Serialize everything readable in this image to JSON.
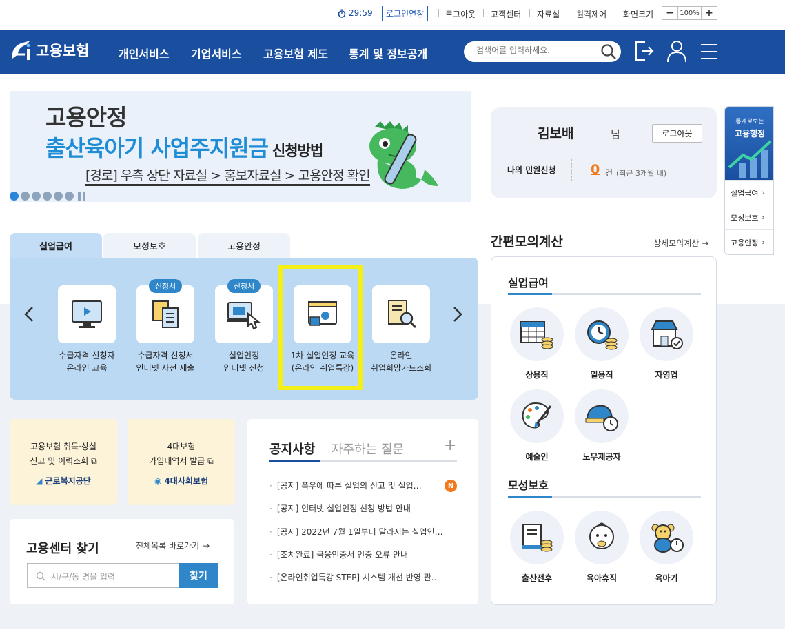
{
  "util": {
    "timer": "29:59",
    "extend": "로그인연장",
    "logout": "로그아웃",
    "support": "고객센터",
    "library": "자료실",
    "remote": "원격제어",
    "screen_size": "화면크기",
    "zoom_minus": "−",
    "zoom_value": "100%",
    "zoom_plus": "+"
  },
  "header": {
    "logo": "고용보험",
    "nav": [
      "개인서비스",
      "기업서비스",
      "고용보험 제도",
      "통계 및 정보공개"
    ],
    "search_placeholder": "검색어를 입력하세요."
  },
  "banner": {
    "line1": "고용안정",
    "line2": "출산육아기 사업주지원금",
    "line2_small": "신청방법",
    "line3": "[경로] 우측 상단 자료실 > 홍보자료실 > 고용안정 확인"
  },
  "user": {
    "name": "김보배",
    "suffix": "님",
    "logout": "로그아웃",
    "minwon_label": "나의 민원신청",
    "count": "0",
    "unit": "건",
    "range": "(최근 3개월 내)"
  },
  "side_widget": {
    "title_small": "통계로보는",
    "title": "고용행정",
    "links": [
      "실업급여",
      "모성보호",
      "고용안정"
    ]
  },
  "tabs": [
    "실업급여",
    "모성보호",
    "고용안정"
  ],
  "services": [
    {
      "line1": "수급자격 신청자",
      "line2": "온라인 교육",
      "badge": ""
    },
    {
      "line1": "수급자격 신청서",
      "line2": "인터넷 사전 제출",
      "badge": "신청서"
    },
    {
      "line1": "실업인정",
      "line2": "인터넷 신청",
      "badge": "신청서"
    },
    {
      "line1": "1차 실업인정 교육",
      "line2": "(온라인 취업특강)",
      "badge": ""
    },
    {
      "line1": "온라인",
      "line2": "취업희망카드조회",
      "badge": ""
    }
  ],
  "quick": [
    {
      "line1": "고용보험 취득·상실",
      "line2": "신고 및 이력조회",
      "org": "근로복지공단"
    },
    {
      "line1": "4대보험",
      "line2": "가입내역서 발급",
      "org": "4대사회보험"
    }
  ],
  "center": {
    "title": "고용센터 찾기",
    "link": "전체목록 바로가기",
    "placeholder": "시/구/동 명을 입력",
    "button": "찾기"
  },
  "notice": {
    "tab1": "공지사항",
    "tab2": "자주하는 질문",
    "plus": "+",
    "new_badge": "N",
    "items": [
      "[공지] 폭우에 따른 실업의 신고 및 실업…",
      "[공지] 인터넷 실업인정 신청 방법 안내",
      "[공지] 2022년 7월 1일부터 달라지는 실업인…",
      "[조치완료] 금융인증서 인증 오류 안내",
      "[온라인취업특강 STEP] 시스템 개선 반영 관…"
    ]
  },
  "calc": {
    "title": "간편모의계산",
    "link": "상세모의계산",
    "section1": "실업급여",
    "items1": [
      "상용직",
      "일용직",
      "자영업",
      "예술인",
      "노무제공자"
    ],
    "section2": "모성보호",
    "items2": [
      "출산전후",
      "육아휴직",
      "육아기"
    ]
  },
  "colors": {
    "brand": "#1a4fa0",
    "accent": "#2f86c8",
    "orange": "#f07a1d",
    "highlight": "#f4ee19"
  }
}
